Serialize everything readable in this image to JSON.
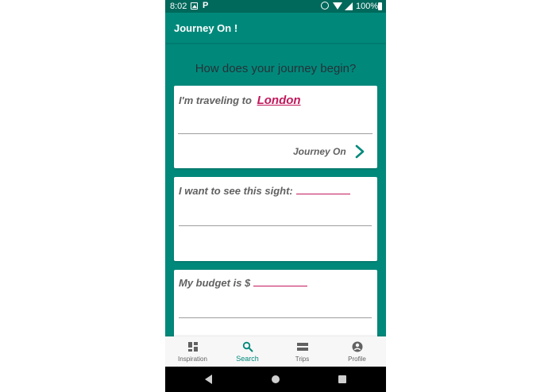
{
  "status_bar": {
    "time": "8:02",
    "p_glyph": "P",
    "battery": "100%",
    "icons": [
      "image-icon",
      "p-icon",
      "alarm-icon",
      "wifi-icon",
      "signal-icon",
      "battery-icon"
    ]
  },
  "app_bar": {
    "title": "Journey On !"
  },
  "main": {
    "headline": "How does your journey begin?",
    "destination_card": {
      "prompt": "I'm traveling to",
      "value": "London",
      "action_label": "Journey On",
      "action_icon": "chevron-right-icon"
    },
    "sight_card": {
      "prompt": "I want to see this sight:"
    },
    "budget_card": {
      "prompt": "My budget is $"
    }
  },
  "bottom_nav": {
    "items": [
      {
        "label": "Inspiration",
        "icon": "dashboard-icon",
        "active": false
      },
      {
        "label": "Search",
        "icon": "search-icon",
        "active": true
      },
      {
        "label": "Trips",
        "icon": "trips-icon",
        "active": false
      },
      {
        "label": "Profile",
        "icon": "profile-icon",
        "active": false
      }
    ]
  },
  "colors": {
    "primary": "#00897b",
    "primary_dark": "#00695c",
    "accent": "#c2185b",
    "text_secondary": "#616161"
  }
}
